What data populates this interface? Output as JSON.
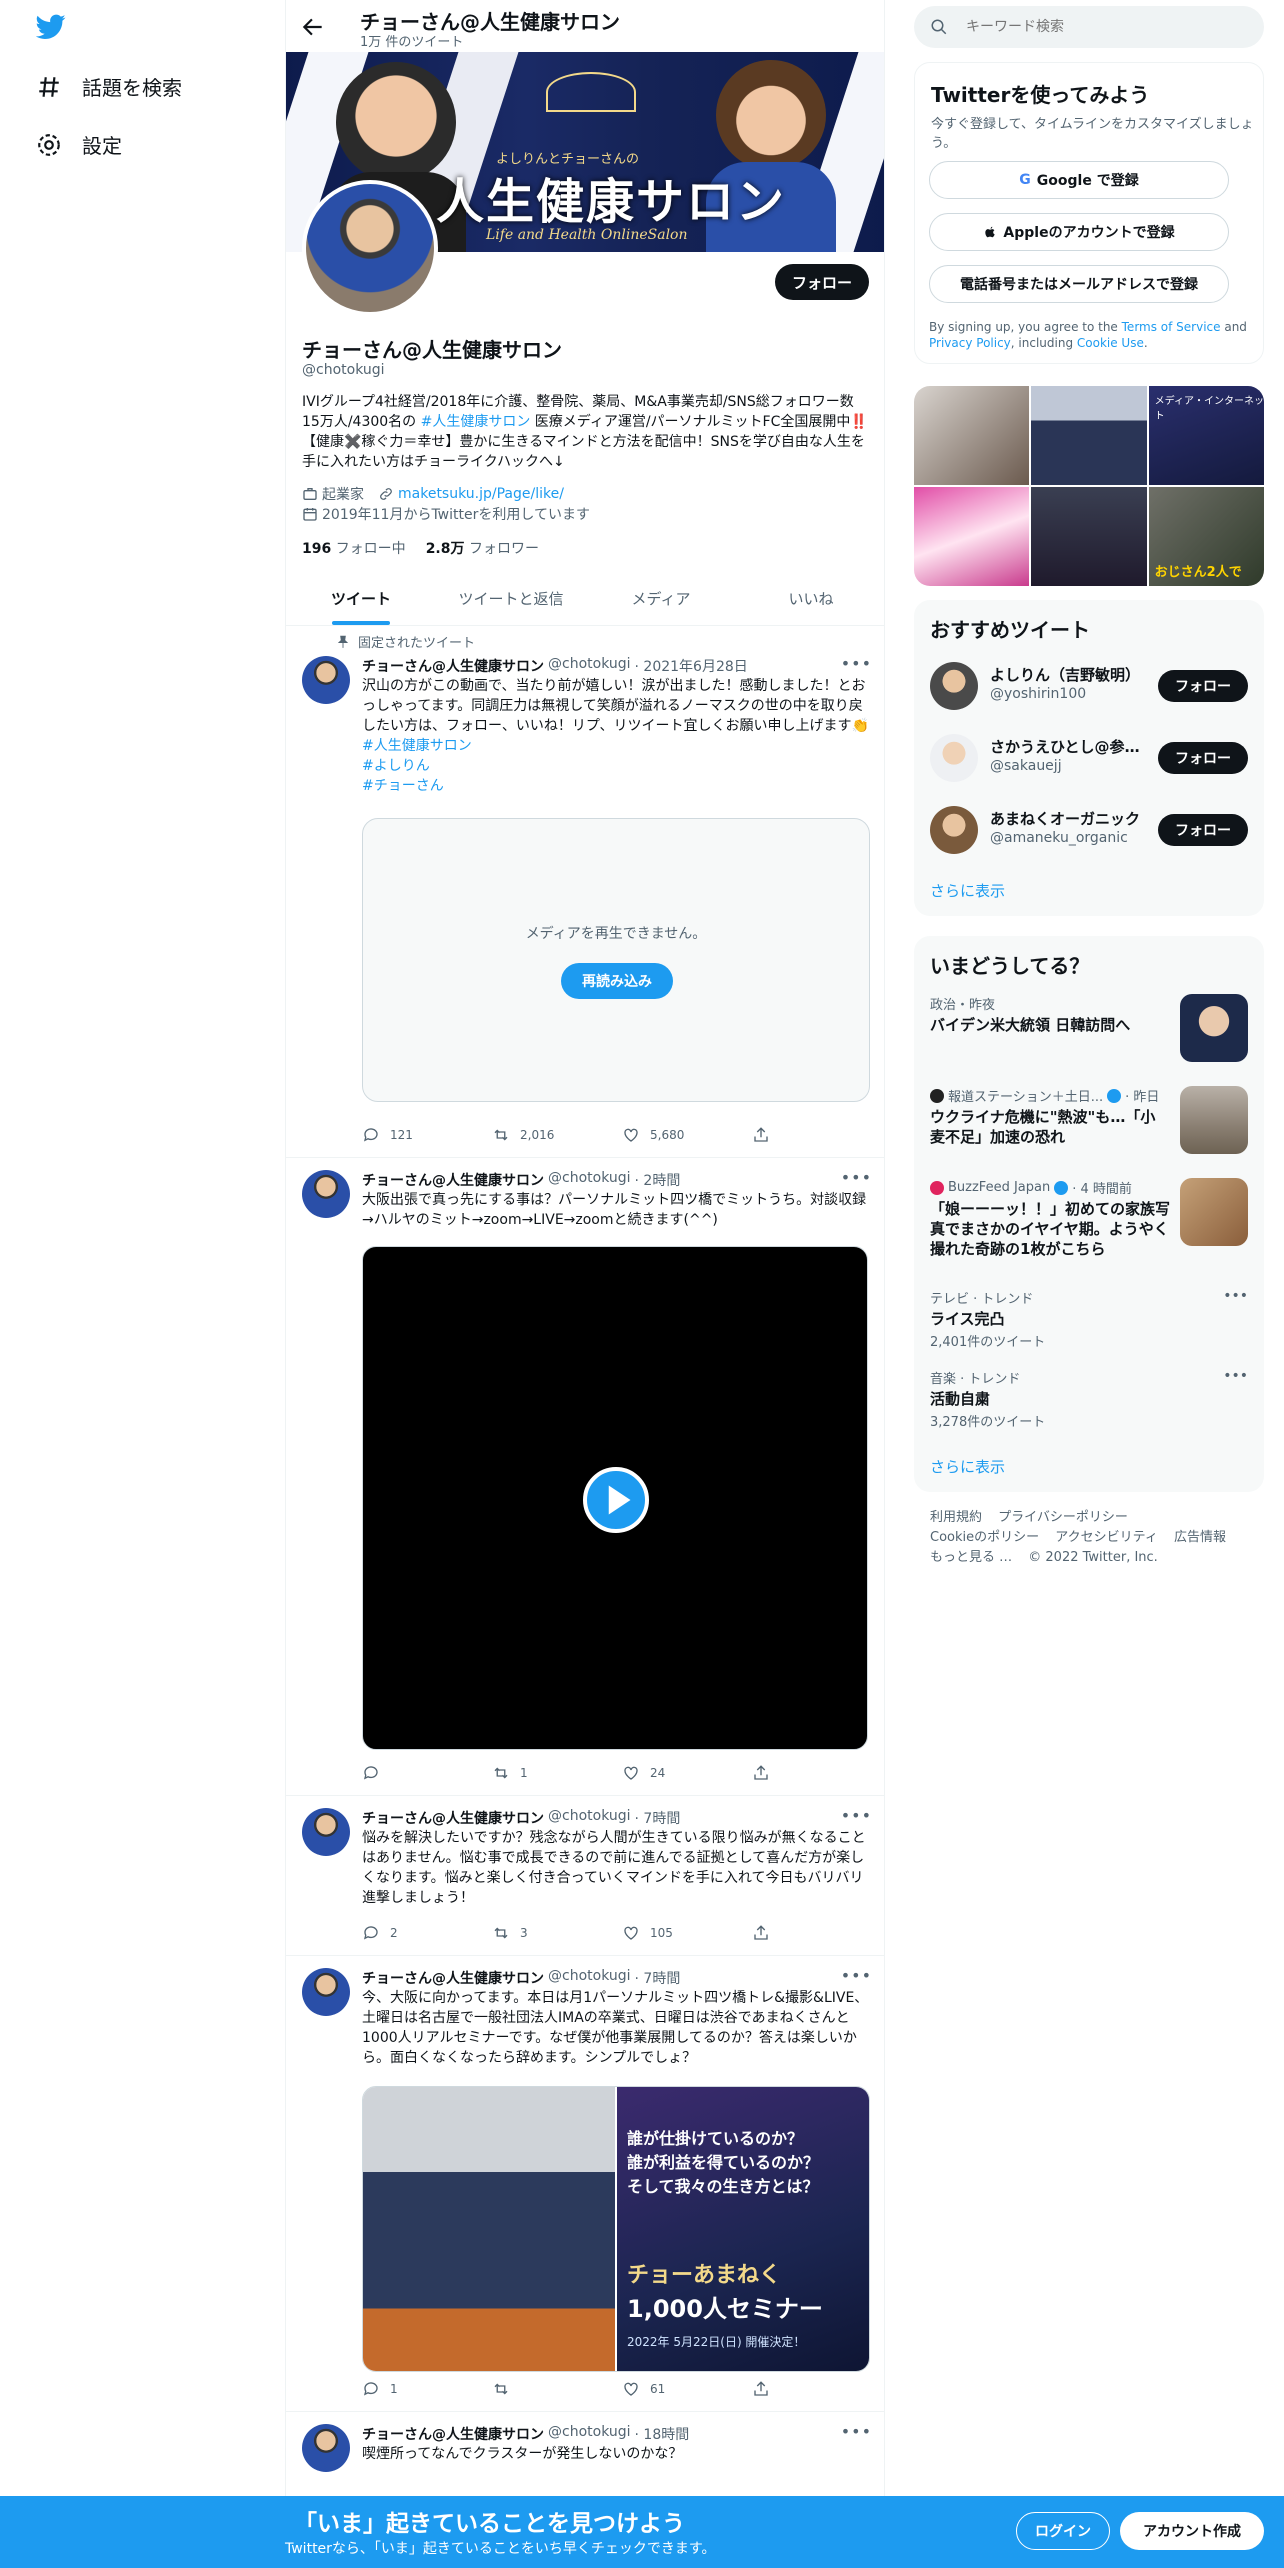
{
  "nav": {
    "explore_label": "話題を検索",
    "settings_label": "設定"
  },
  "header": {
    "name": "チョーさん@人生健康サロン",
    "tweet_count": "1万 件のツイート"
  },
  "banner": {
    "title": "人生健康サロン",
    "subtitle": "よしりんとチョーさんの",
    "en": "Life and Health OnlineSalon"
  },
  "profile": {
    "display_name": "チョーさん@人生健康サロン",
    "handle": "@chotokugi",
    "follow_label": "フォロー",
    "bio_1": "IVIグループ4社経営/2018年に介護、整骨院、薬局、M&A事業売却/SNS総フォロワー数15万人/4300名の ",
    "bio_tag": "#人生健康サロン",
    "bio_2": " 医療メディア運営/パーソナルミットFC全国展開中‼️【健康✖️稼ぐ力＝幸せ】豊かに生きるマインドと方法を配信中！SNSを学び自由な人生を手に入れたい方はチョーライクハックへ↓",
    "category": "起業家",
    "url": "maketsuku.jp/Page/like/",
    "joined": "2019年11月からTwitterを利用しています",
    "following_count": "196",
    "following_label": "フォロー中",
    "followers_count": "2.8万",
    "followers_label": "フォロワー"
  },
  "tabs": [
    "ツイート",
    "ツイートと返信",
    "メディア",
    "いいね"
  ],
  "tweets": [
    {
      "pinned_label": "固定されたツイート",
      "name": "チョーさん@人生健康サロン",
      "handle": "@chotokugi",
      "time": "· 2021年6月28日",
      "text": "沢山の方がこの動画で、当たり前が嬉しい！涙が出ました！感動しました！とおっしゃってます。同調圧力は無視して笑顔が溢れるノーマスクの世の中を取り戻したい方は、フォロー、いいね！リプ、リツイート宜しくお願い申し上げます👏",
      "hashtags": [
        "#人生健康サロン",
        "#よしりん",
        "#チョーさん"
      ],
      "media_error": "メディアを再生できません。",
      "reload_label": "再読み込み",
      "replies": "121",
      "retweets": "2,016",
      "likes": "5,680"
    },
    {
      "name": "チョーさん@人生健康サロン",
      "handle": "@chotokugi",
      "time": "· 2時間",
      "text": "大阪出張で真っ先にする事は？パーソナルミット四ツ橋でミットうち。対談収録→ハルヤのミット→zoom→LIVE→zoomと続きます(^^)",
      "replies": "",
      "retweets": "1",
      "likes": "24"
    },
    {
      "name": "チョーさん@人生健康サロン",
      "handle": "@chotokugi",
      "time": "· 7時間",
      "text": "悩みを解決したいですか？残念ながら人間が生きている限り悩みが無くなることはありません。悩む事で成長できるので前に進んでる証拠として喜んだ方が楽しくなります。悩みと楽しく付き合っていくマインドを手に入れて今日もバリバリ進撃しましょう！",
      "replies": "2",
      "retweets": "3",
      "likes": "105"
    },
    {
      "name": "チョーさん@人生健康サロン",
      "handle": "@chotokugi",
      "time": "· 7時間",
      "text": "今、大阪に向かってます。本日は月1パーソナルミット四ツ橋トレ&撮影&LIVE、土曜日は名古屋で一般社団法人IMAの卒業式、日曜日は渋谷であまねくさんと1000人リアルセミナーです。なぜ僕が他事業展開してるのか？答えは楽しいから。面白くなくなったら辞めます。シンプルでしょ？",
      "photo_text_1": "誰が仕掛けているのか？",
      "photo_text_2": "誰が利益を得ているのか？",
      "photo_text_3": "そして我々の生き方とは？",
      "photo_text_4": "チョーあまねく",
      "photo_text_5": "1,000人セミナー",
      "photo_text_6": "2022年 5月22日(日) 開催決定！",
      "replies": "1",
      "retweets": "",
      "likes": "61"
    },
    {
      "name": "チョーさん@人生健康サロン",
      "handle": "@chotokugi",
      "time": "· 18時間",
      "text": "喫煙所ってなんでクラスターが発生しないのかな？"
    }
  ],
  "search": {
    "placeholder": "キーワード検索"
  },
  "signup": {
    "title": "Twitterを使ってみよう",
    "subtitle": "今すぐ登録して、タイムラインをカスタマイズしましょう。",
    "google": "Google で登録",
    "apple": "Appleのアカウントで登録",
    "phone": "電話番号またはメールアドレスで登録",
    "terms_1": "By signing up, you agree to the ",
    "terms_tos": "Terms of Service",
    "terms_2": " and ",
    "terms_privacy": "Privacy Policy",
    "terms_3": ", including ",
    "terms_cookie": "Cookie Use",
    "terms_4": "."
  },
  "media_grid_text": {
    "cell3": "メディア・インターネット",
    "cell6": "おじさん2人で"
  },
  "recommended": {
    "title": "おすすめツイート",
    "users": [
      {
        "name": "よしりん（吉野敏明）",
        "handle": "@yoshirin100",
        "follow": "フォロー"
      },
      {
        "name": "さかうえひとし@参議院議員",
        "handle": "@sakauejj",
        "follow": "フォロー"
      },
      {
        "name": "あまねくオーガニック",
        "handle": "@amaneku_organic",
        "follow": "フォロー"
      }
    ],
    "more": "さらに表示"
  },
  "trends": {
    "title": "いまどうしてる？",
    "items": [
      {
        "category": "政治・昨夜",
        "title": "バイデン米大統領 日韓訪問へ"
      },
      {
        "category": "報道ステーション＋土日...",
        "time": "· 昨日",
        "title": "ウクライナ危機に\"熱波\"も…「小麦不足」加速の恐れ"
      },
      {
        "category": "BuzzFeed Japan",
        "time": "· 4 時間前",
        "title": "「娘ーーーッ！！」初めての家族写真でまさかのイヤイヤ期。ようやく撮れた奇跡の1枚がこちら"
      },
      {
        "category": "テレビ · トレンド",
        "title": "ライス完凸",
        "count": "2,401件のツイート"
      },
      {
        "category": "音楽 · トレンド",
        "title": "活動自粛",
        "count": "3,278件のツイート"
      }
    ],
    "more": "さらに表示"
  },
  "footer": {
    "links": [
      "利用規約",
      "プライバシーポリシー",
      "Cookieのポリシー",
      "アクセシビリティ",
      "広告情報",
      "もっと見る …",
      "© 2022 Twitter, Inc."
    ]
  },
  "bottom_bar": {
    "title": "「いま」起きていることを見つけよう",
    "subtitle": "Twitterなら、「いま」起きていることをいち早くチェックできます。",
    "login": "ログイン",
    "signup": "アカウント作成"
  },
  "colors": {
    "accent": "#1d9bf0",
    "text": "#0f1419",
    "muted": "#536471"
  }
}
